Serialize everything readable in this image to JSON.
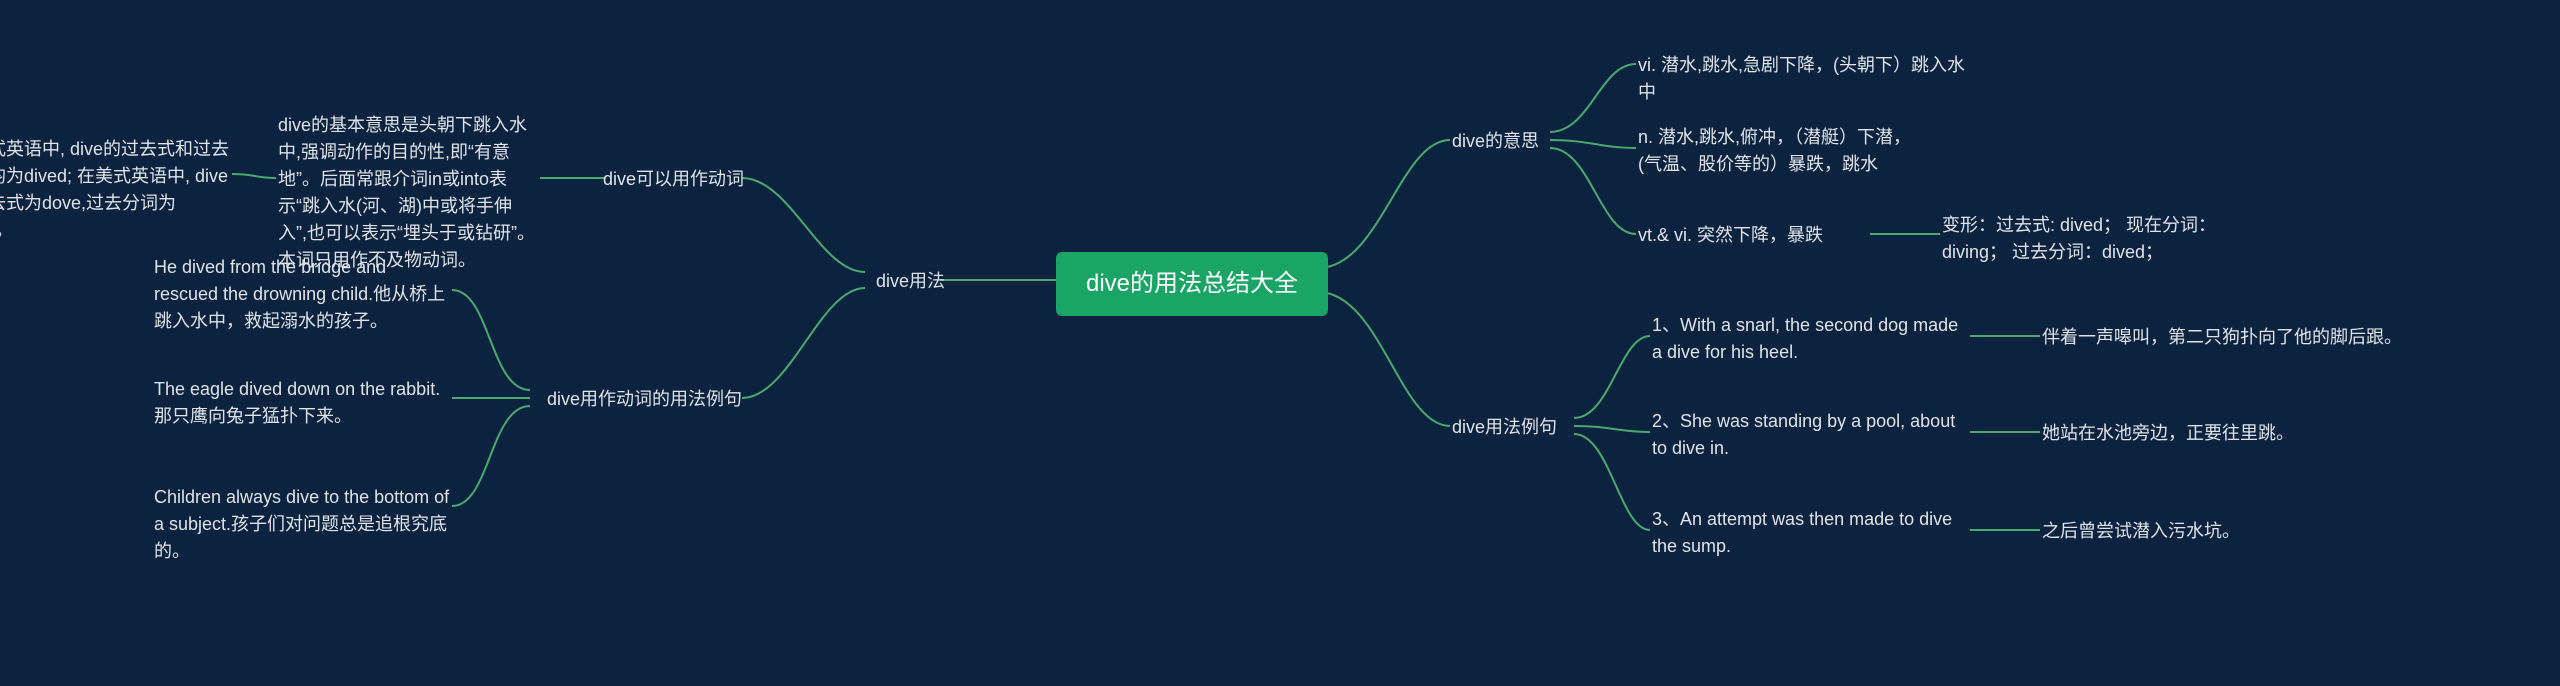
{
  "center": "dive的用法总结大全",
  "left": {
    "usage_label": "dive用法",
    "verb_label": "dive可以用作动词",
    "verb_desc": "dive的基本意思是头朝下跳入水中,强调动作的目的性,即“有意地”。后面常跟介词in或into表示“跳入水(河、湖)中或将手伸入”,也可以表示“埋头于或钻研”。本词只用作不及物动词。",
    "verb_desc_2": "在英式英语中, dive的过去式和过去分词均为dived; 在美式英语中, dive的过去式为dove,过去分词为dived。",
    "examples_label": "dive用作动词的用法例句",
    "ex1": "He dived from the bridge and rescued the drowning child.他从桥上跳入水中，救起溺水的孩子。",
    "ex2": "The eagle dived down on the rabbit.那只鹰向兔子猛扑下来。",
    "ex3": "Children always dive to the bottom of a subject.孩子们对问题总是追根究底的。"
  },
  "right": {
    "meaning_label": "dive的意思",
    "meaning_vi": "vi. 潜水,跳水,急剧下降，(头朝下）跳入水中",
    "meaning_n": "n. 潜水,跳水,俯冲，（潜艇）下潜，(气温、股价等的）暴跌，跳水",
    "meaning_vt": "vt.& vi. 突然下降，暴跌",
    "meaning_forms": "变形：过去式: dived； 现在分词：diving； 过去分词：dived；",
    "examples_label": "dive用法例句",
    "ex1_en": "1、With a snarl, the second dog made a dive for his heel.",
    "ex1_zh": "伴着一声嗥叫，第二只狗扑向了他的脚后跟。",
    "ex2_en": "2、She was standing by a pool, about to dive in.",
    "ex2_zh": "她站在水池旁边，正要往里跳。",
    "ex3_en": "3、An attempt was then made to dive the sump.",
    "ex3_zh": "之后曾尝试潜入污水坑。"
  }
}
